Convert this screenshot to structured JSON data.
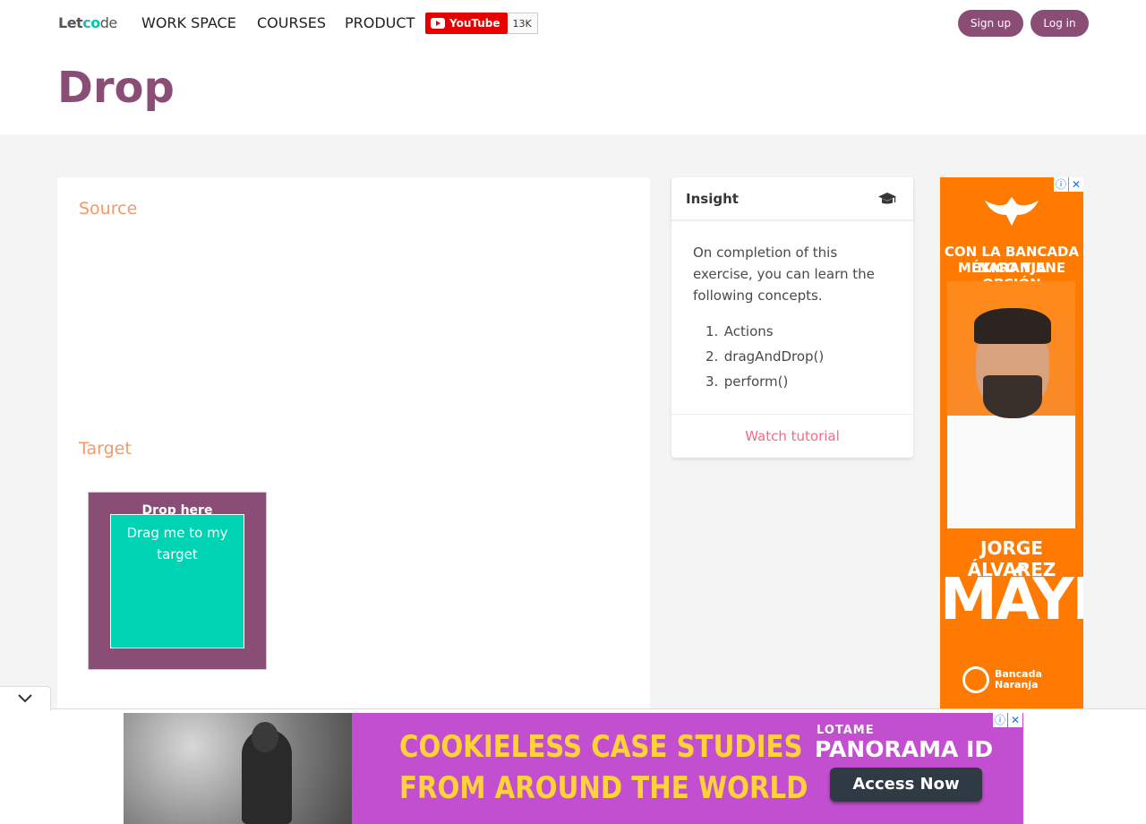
{
  "header": {
    "logo": {
      "let": "Let",
      "c": "c",
      "o": "o",
      "de": "de"
    },
    "nav": [
      "WORK SPACE",
      "COURSES",
      "PRODUCT"
    ],
    "youtube": {
      "label": "YouTube",
      "count": "13K"
    },
    "signup_label": "Sign up",
    "login_label": "Log in"
  },
  "page": {
    "title": "Drop"
  },
  "exercise": {
    "source_label": "Source",
    "target_label": "Target",
    "drop_text": "Drop here",
    "drag_text": "Drag me to my target"
  },
  "insight": {
    "title": "Insight",
    "icon": "graduation-cap-icon",
    "body": "On completion of this exercise, you can learn the following concepts.",
    "concepts": [
      "Actions",
      "dragAndDrop()",
      "perform()"
    ],
    "watch_label": "Watch tutorial"
  },
  "ad_right": {
    "slogan_1": "CON LA BANCADA NARANJA",
    "slogan_2": "MÉXICO TIENE OPCIÓN",
    "name_1": "JORGE ÁLVAREZ",
    "name_2": "MÁYNEZ",
    "logo_1": "Bancada",
    "logo_2": "Naranja",
    "info_icon": "ⓘ",
    "close_icon": "✕"
  },
  "banner": {
    "line_1": "COOKIELESS CASE STUDIES",
    "line_2": "FROM AROUND THE WORLD",
    "brand_small": "LOTAME",
    "brand_large": "PANORAMA ID",
    "cta": "Access Now",
    "info_icon": "ⓘ",
    "close_icon": "✕"
  },
  "colors": {
    "brand_purple": "#8a4d76",
    "accent_orange": "#f5986a",
    "drag_teal": "#00d2b4",
    "link_pink": "#f46a86",
    "background": "#f4f4f4"
  }
}
